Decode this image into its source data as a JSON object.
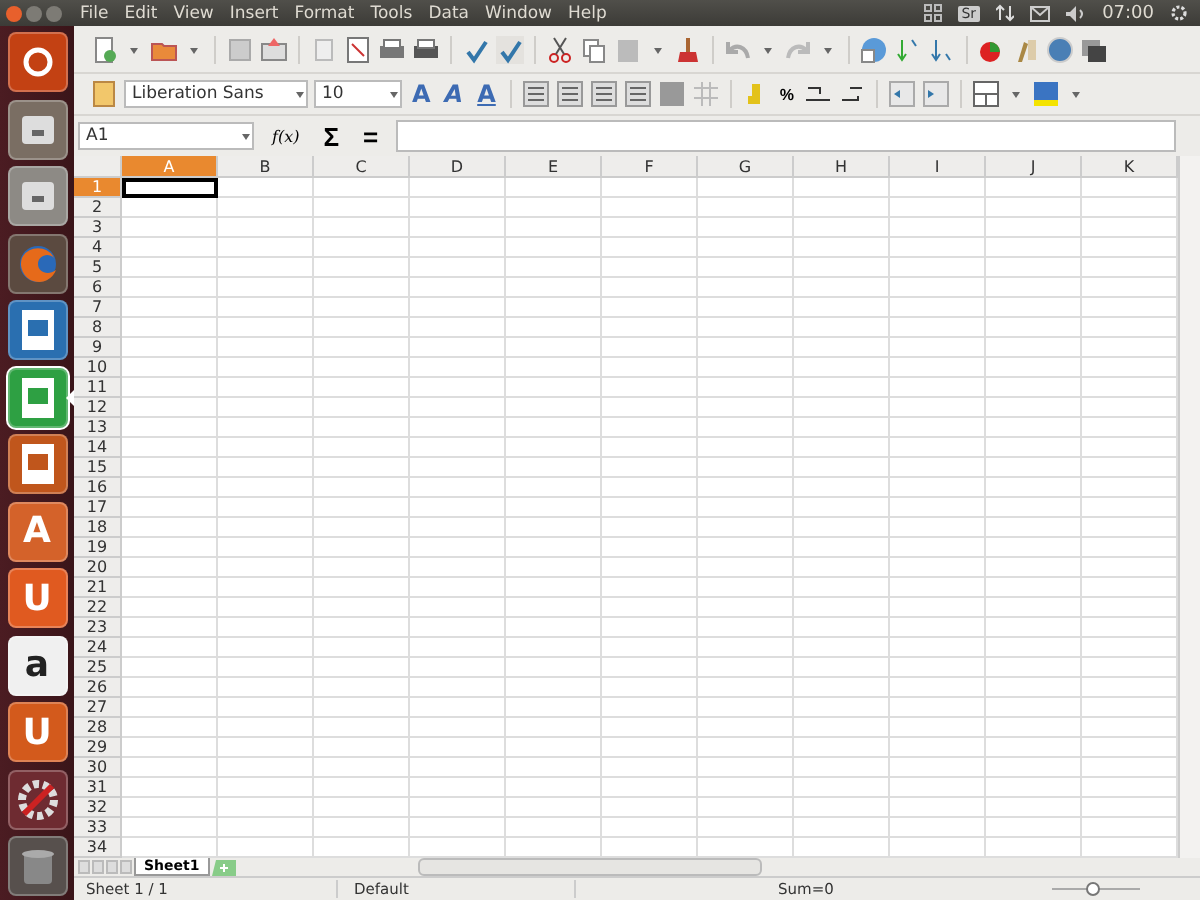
{
  "top_bar": {
    "menu": [
      "File",
      "Edit",
      "View",
      "Insert",
      "Format",
      "Tools",
      "Data",
      "Window",
      "Help"
    ],
    "keyboard_layout": "Sr",
    "clock": "07:00"
  },
  "launcher": [
    {
      "kind": "ubuntu",
      "selected": false
    },
    {
      "kind": "photos",
      "selected": false
    },
    {
      "kind": "files",
      "selected": false
    },
    {
      "kind": "browser",
      "selected": false
    },
    {
      "kind": "writer",
      "selected": false
    },
    {
      "kind": "calc",
      "selected": true
    },
    {
      "kind": "impress",
      "selected": false
    },
    {
      "kind": "software",
      "glyph": "A",
      "selected": false
    },
    {
      "kind": "ubuntu-one",
      "glyph": "U",
      "selected": false
    },
    {
      "kind": "amazon",
      "glyph": "a",
      "selected": false
    },
    {
      "kind": "music",
      "glyph": "U",
      "selected": false
    },
    {
      "kind": "settings",
      "selected": false
    },
    {
      "kind": "trash",
      "selected": false
    }
  ],
  "formatting": {
    "font_name": "Liberation Sans",
    "font_size": "10",
    "style_buttons": [
      {
        "label": "A",
        "kind": "bold"
      },
      {
        "label": "A",
        "kind": "italic"
      },
      {
        "label": "A",
        "kind": "underline"
      }
    ],
    "percent": "%"
  },
  "formula_bar": {
    "name_box": "A1",
    "function_wizard": "f(x)",
    "sum": "Σ",
    "equals": "="
  },
  "sheet": {
    "columns": [
      {
        "label": "A",
        "selected": true
      },
      {
        "label": "B",
        "selected": false
      },
      {
        "label": "C",
        "selected": false
      },
      {
        "label": "D",
        "selected": false
      },
      {
        "label": "E",
        "selected": false
      },
      {
        "label": "F",
        "selected": false
      },
      {
        "label": "G",
        "selected": false
      },
      {
        "label": "H",
        "selected": false
      },
      {
        "label": "I",
        "selected": false
      },
      {
        "label": "J",
        "selected": false
      },
      {
        "label": "K",
        "selected": false
      }
    ],
    "rows": [
      {
        "label": "1",
        "selected": true
      },
      {
        "label": "2",
        "selected": false
      },
      {
        "label": "3",
        "selected": false
      },
      {
        "label": "4",
        "selected": false
      },
      {
        "label": "5",
        "selected": false
      },
      {
        "label": "6",
        "selected": false
      },
      {
        "label": "7",
        "selected": false
      },
      {
        "label": "8",
        "selected": false
      },
      {
        "label": "9",
        "selected": false
      },
      {
        "label": "10",
        "selected": false
      },
      {
        "label": "11",
        "selected": false
      },
      {
        "label": "12",
        "selected": false
      },
      {
        "label": "13",
        "selected": false
      },
      {
        "label": "14",
        "selected": false
      },
      {
        "label": "15",
        "selected": false
      },
      {
        "label": "16",
        "selected": false
      },
      {
        "label": "17",
        "selected": false
      },
      {
        "label": "18",
        "selected": false
      },
      {
        "label": "19",
        "selected": false
      },
      {
        "label": "20",
        "selected": false
      },
      {
        "label": "21",
        "selected": false
      },
      {
        "label": "22",
        "selected": false
      },
      {
        "label": "23",
        "selected": false
      },
      {
        "label": "24",
        "selected": false
      },
      {
        "label": "25",
        "selected": false
      },
      {
        "label": "26",
        "selected": false
      },
      {
        "label": "27",
        "selected": false
      },
      {
        "label": "28",
        "selected": false
      },
      {
        "label": "29",
        "selected": false
      },
      {
        "label": "30",
        "selected": false
      },
      {
        "label": "31",
        "selected": false
      },
      {
        "label": "32",
        "selected": false
      },
      {
        "label": "33",
        "selected": false
      },
      {
        "label": "34",
        "selected": false
      }
    ],
    "tabs": [
      {
        "label": "Sheet1",
        "selected": true
      }
    ]
  },
  "status_bar": {
    "sheet": "Sheet 1 / 1",
    "page_style": "Default",
    "sum": "Sum=0",
    "zoom": {
      "level": 0.45
    }
  }
}
